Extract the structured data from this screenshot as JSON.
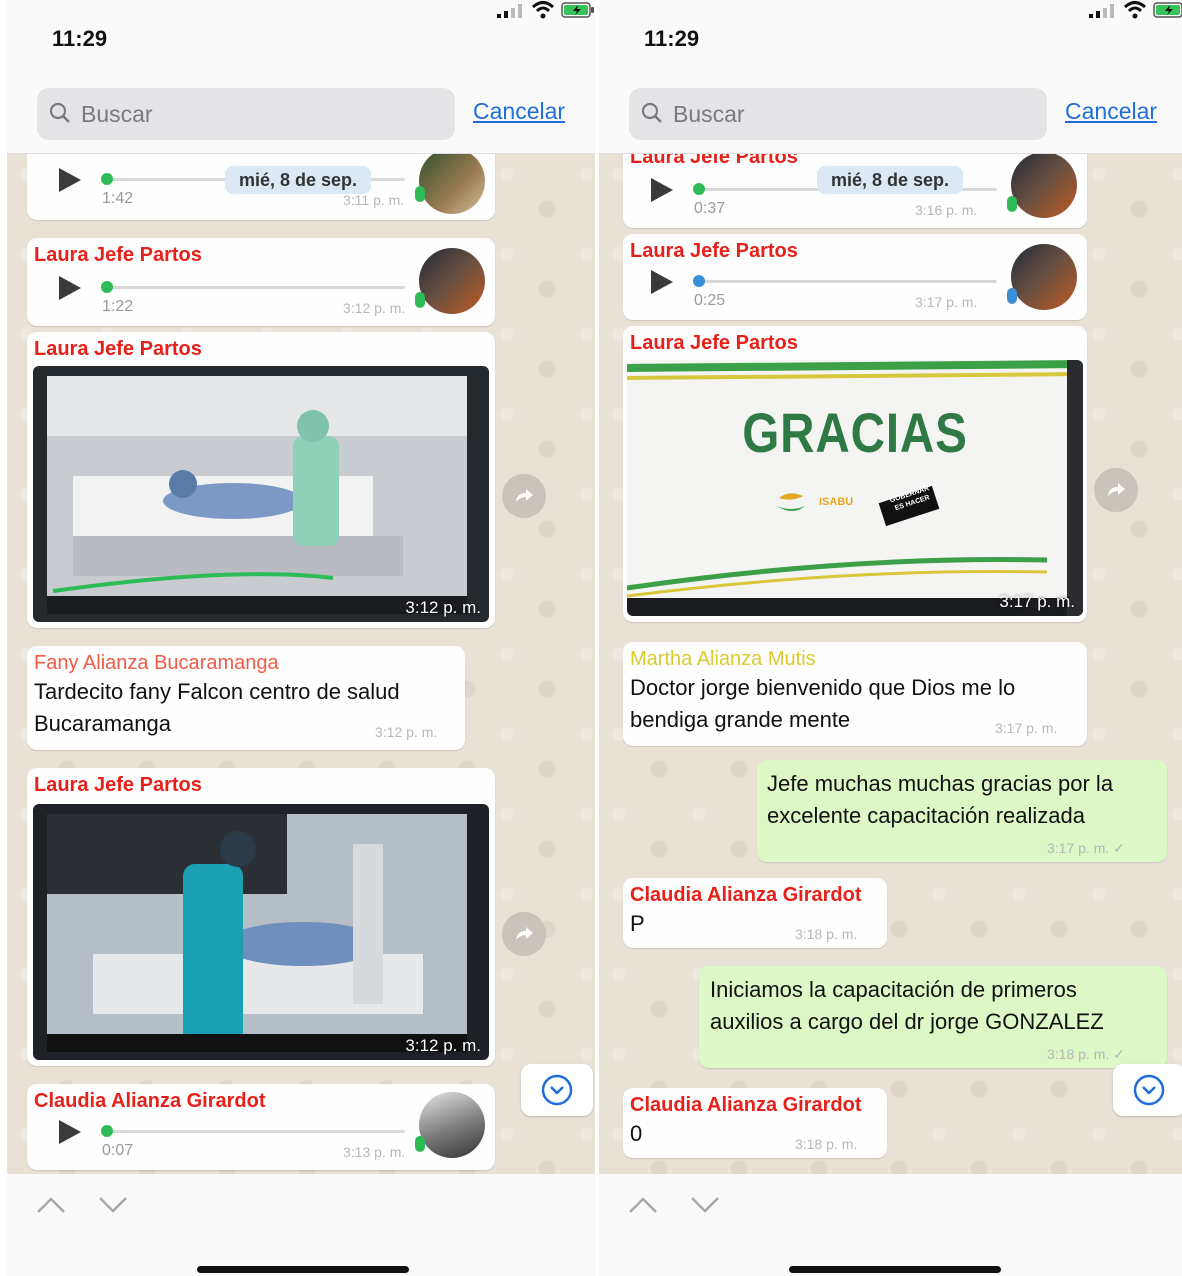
{
  "status": {
    "time": "11:29"
  },
  "search": {
    "placeholder": "Buscar",
    "cancel": "Cancelar"
  },
  "colors": {
    "laura": "#e8201a",
    "fany": "#ef5b47",
    "claudia": "#e8201a",
    "martha": "#d9cc2c",
    "accent": "#1e6fd9",
    "outgoing": "#dcf8c6"
  },
  "left": {
    "date_pill": "mié, 8 de sep.",
    "audio0": {
      "duration": "1:42",
      "time": "3:11 p. m."
    },
    "audio1": {
      "sender": "Laura Jefe Partos",
      "duration": "1:22",
      "time": "3:12 p. m."
    },
    "image1": {
      "sender": "Laura Jefe Partos",
      "time": "3:12 p. m."
    },
    "text1": {
      "sender": "Fany Alianza Bucaramanga",
      "line1": "Tardecito fany Falcon centro de salud",
      "line2": "Bucaramanga",
      "time": "3:12 p. m."
    },
    "image2": {
      "sender": "Laura Jefe Partos",
      "time": "3:12 p. m."
    },
    "audio2": {
      "sender": "Claudia Alianza Girardot",
      "duration": "0:07",
      "time": "3:13 p. m."
    }
  },
  "right": {
    "date_pill": "mié, 8 de sep.",
    "audio0": {
      "sender": "Laura Jefe Partos",
      "duration": "0:37",
      "time": "3:16 p. m."
    },
    "audio1": {
      "sender": "Laura Jefe Partos",
      "duration": "0:25",
      "time": "3:17 p. m."
    },
    "image1": {
      "sender": "Laura Jefe Partos",
      "time": "3:17 p. m.",
      "slide_title": "GRACIAS",
      "logo_text": "ISABU",
      "logo2_line1": "GOBERNAR",
      "logo2_line2": "ES HACER"
    },
    "text1": {
      "sender": "Martha Alianza Mutis",
      "line1": "Doctor jorge bienvenido que Dios me lo",
      "line2": "bendiga grande mente",
      "time": "3:17 p. m."
    },
    "out1": {
      "line1": "Jefe muchas muchas gracias por la",
      "line2": "excelente capacitación realizada",
      "time": "3:17 p. m."
    },
    "text2": {
      "sender": "Claudia Alianza Girardot",
      "line1": "P",
      "time": "3:18 p. m."
    },
    "out2": {
      "line1": "Iniciamos la capacitación de primeros",
      "line2": "auxilios a cargo del dr jorge GONZALEZ",
      "time": "3:18 p. m."
    },
    "text3": {
      "sender": "Claudia Alianza Girardot",
      "line1": "0",
      "time": "3:18 p. m."
    }
  },
  "icons": [
    "signal-icon",
    "wifi-icon",
    "battery-icon",
    "search-icon",
    "play-icon",
    "mic-icon",
    "forward-icon",
    "chevron-down-circle-icon",
    "chevron-up-icon",
    "chevron-down-icon",
    "check-icon"
  ]
}
